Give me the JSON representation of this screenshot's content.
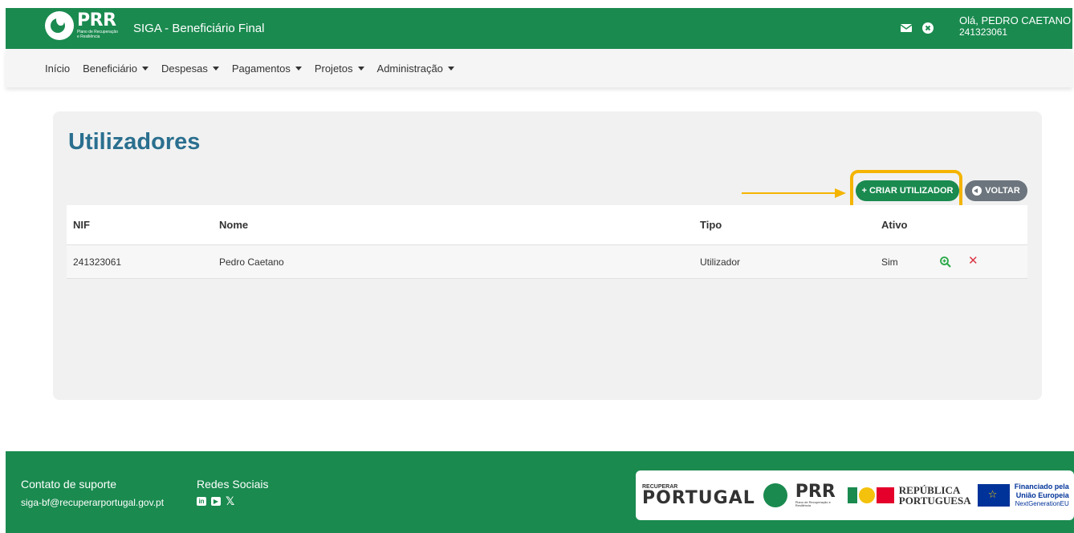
{
  "header": {
    "logo_text": "PRR",
    "logo_sub": "Plano de Recuperação e Resiliência",
    "app_title": "SIGA - Beneficiário Final",
    "user_greeting": "Olá, PEDRO CAETANO",
    "user_nif": "241323061",
    "icons": [
      "mail-icon",
      "close-circle-icon"
    ]
  },
  "nav": {
    "items": [
      {
        "label": "Início",
        "dropdown": false
      },
      {
        "label": "Beneficiário",
        "dropdown": true
      },
      {
        "label": "Despesas",
        "dropdown": true
      },
      {
        "label": "Pagamentos",
        "dropdown": true
      },
      {
        "label": "Projetos",
        "dropdown": true
      },
      {
        "label": "Administração",
        "dropdown": true
      }
    ]
  },
  "main": {
    "title": "Utilizadores",
    "create_button": "+ CRIAR UTILIZADOR",
    "back_button": "VOLTAR",
    "table": {
      "headers": [
        "NIF",
        "Nome",
        "Tipo",
        "Ativo"
      ],
      "rows": [
        {
          "nif": "241323061",
          "nome": "Pedro Caetano",
          "tipo": "Utilizador",
          "ativo": "Sim"
        }
      ]
    }
  },
  "footer": {
    "support_title": "Contato de suporte",
    "support_email": "siga-bf@recuperarportugal.gov.pt",
    "social_title": "Redes Sociais",
    "social_icons": [
      "linkedin-icon",
      "youtube-icon",
      "x-icon"
    ],
    "logos": {
      "recuperar_small": "RECUPERAR",
      "recuperar_big": "PORTUGAL",
      "prr": "PRR",
      "prr_sub": "Plano de Recuperação e Resiliência",
      "republica": "REPÚBLICA PORTUGUESA",
      "eu_line1": "Financiado pela",
      "eu_line2": "União Europeia",
      "eu_line3": "NextGenerationEU"
    }
  },
  "colors": {
    "brand_green": "#1a8a4f",
    "title_blue": "#2a6f8f",
    "highlight": "#f4b400",
    "danger": "#dc3545",
    "secondary": "#6c757d"
  }
}
